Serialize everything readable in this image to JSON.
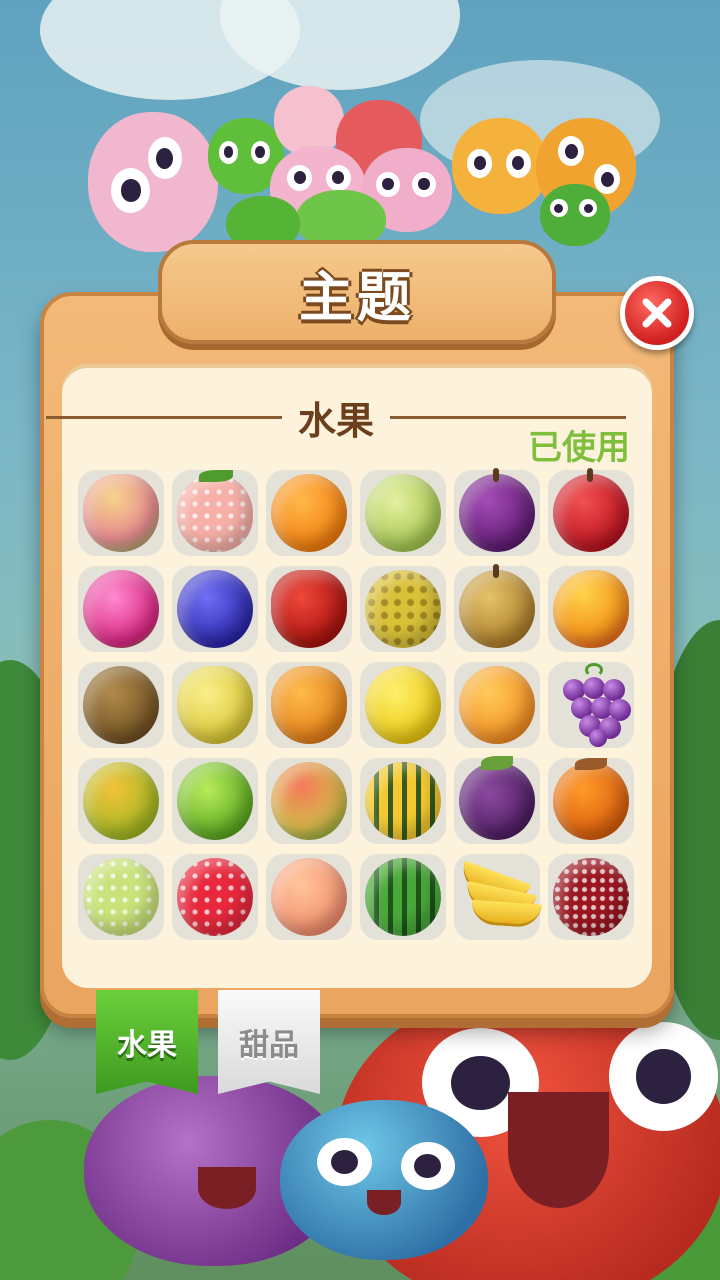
{
  "modal": {
    "title": "主题",
    "section_title": "水果",
    "status_label": "已使用"
  },
  "fruits": [
    {
      "name": "guava-icon"
    },
    {
      "name": "strawberry-icon"
    },
    {
      "name": "orange-icon"
    },
    {
      "name": "melon-icon"
    },
    {
      "name": "plum-icon"
    },
    {
      "name": "apple-icon"
    },
    {
      "name": "dragon-fruit-icon"
    },
    {
      "name": "blueberry-icon"
    },
    {
      "name": "wax-apple-icon"
    },
    {
      "name": "durian-icon"
    },
    {
      "name": "pear-icon"
    },
    {
      "name": "mango-icon"
    },
    {
      "name": "kiwi-icon"
    },
    {
      "name": "pomelo-icon"
    },
    {
      "name": "papaya-icon"
    },
    {
      "name": "lemon-icon"
    },
    {
      "name": "apricot-icon"
    },
    {
      "name": "grapes-icon"
    },
    {
      "name": "tangerine-icon"
    },
    {
      "name": "lime-icon"
    },
    {
      "name": "nectarine-icon"
    },
    {
      "name": "pepino-melon-icon"
    },
    {
      "name": "mangosteen-icon"
    },
    {
      "name": "persimmon-icon"
    },
    {
      "name": "custard-apple-icon"
    },
    {
      "name": "raspberry-icon"
    },
    {
      "name": "peach-icon"
    },
    {
      "name": "watermelon-icon"
    },
    {
      "name": "banana-icon"
    },
    {
      "name": "bayberry-icon"
    }
  ],
  "tabs": {
    "fruit": "水果",
    "dessert": "甜品"
  },
  "colors": {
    "panel": "#eaa55f",
    "inner": "#fdf3dc",
    "used": "#7fbf3d",
    "close": "#d01f1f",
    "tab_active": "#4fae28"
  }
}
